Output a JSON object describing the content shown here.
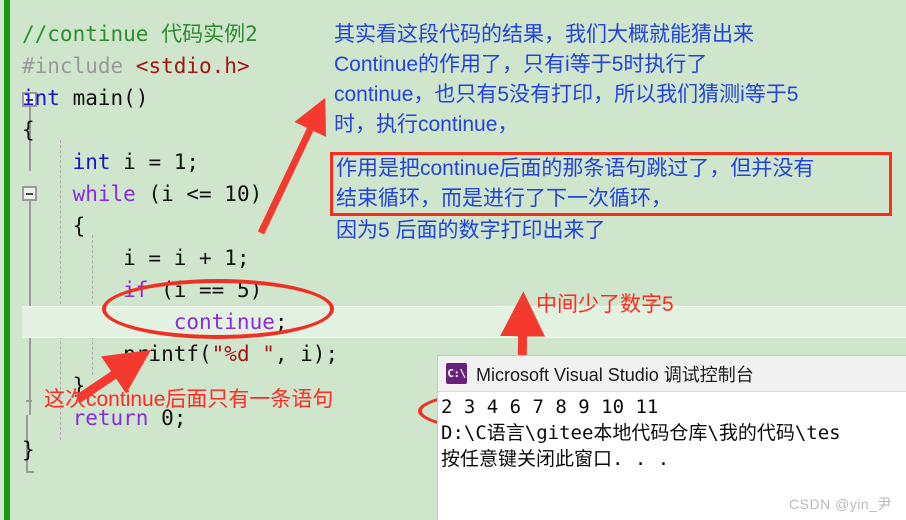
{
  "editor": {
    "code_lines": [
      {
        "segments": [
          {
            "text": "//continue 代码实例2",
            "cls": "cmt"
          }
        ]
      },
      {
        "segments": [
          {
            "text": "#include ",
            "cls": "pp"
          },
          {
            "text": "<stdio.h>",
            "cls": "hdr"
          }
        ]
      },
      {
        "segments": [
          {
            "text": "int",
            "cls": "kw"
          },
          {
            "text": " main()",
            "cls": "num"
          }
        ]
      },
      {
        "segments": [
          {
            "text": "{",
            "cls": "num"
          }
        ]
      },
      {
        "segments": [
          {
            "text": "    ",
            "cls": "num"
          },
          {
            "text": "int",
            "cls": "kw"
          },
          {
            "text": " i = 1;",
            "cls": "num"
          }
        ]
      },
      {
        "segments": [
          {
            "text": "    ",
            "cls": "num"
          },
          {
            "text": "while",
            "cls": "kw2"
          },
          {
            "text": " (i <= 10)",
            "cls": "num"
          }
        ]
      },
      {
        "segments": [
          {
            "text": "    {",
            "cls": "num"
          }
        ]
      },
      {
        "segments": [
          {
            "text": "        i = i + 1;",
            "cls": "num"
          }
        ]
      },
      {
        "segments": [
          {
            "text": "        ",
            "cls": "num"
          },
          {
            "text": "if",
            "cls": "kw2"
          },
          {
            "text": " (i == 5)",
            "cls": "num"
          }
        ]
      },
      {
        "segments": [
          {
            "text": "            ",
            "cls": "num"
          },
          {
            "text": "continue",
            "cls": "kw2"
          },
          {
            "text": ";",
            "cls": "num"
          }
        ]
      },
      {
        "segments": [
          {
            "text": "        printf(",
            "cls": "num"
          },
          {
            "text": "\"%d \"",
            "cls": "str"
          },
          {
            "text": ", i);",
            "cls": "num"
          }
        ]
      },
      {
        "segments": [
          {
            "text": "    }",
            "cls": "num"
          }
        ]
      },
      {
        "segments": [
          {
            "text": "    ",
            "cls": "num"
          },
          {
            "text": "return",
            "cls": "kw2"
          },
          {
            "text": " 0;",
            "cls": "num"
          }
        ]
      },
      {
        "segments": [
          {
            "text": "}",
            "cls": "num"
          }
        ]
      }
    ],
    "highlighted_line_index": 9,
    "margin_color": "#119b11"
  },
  "annotations": {
    "blue_top": "其实看这段代码的结果，我们大概就能猜出来\nContinue的作用了，只有i等于5时执行了\ncontinue，也只有5没有打印，所以我们猜测i等于5\n时，执行continue，",
    "blue_boxed": "作用是把continue后面的那条语句跳过了，但并没有\n结束循环，而是进行了下一次循环，",
    "blue_bottom": "因为5 后面的数字打印出来了",
    "red_missing_five": "中间少了数字5",
    "red_only_one_stmt": "这次continue后面只有一条语句",
    "blue_color": "#2244dd",
    "red_color": "#ff2a21",
    "box_color": "#fb2c1c",
    "ellipse_color": "#ee3124"
  },
  "console": {
    "icon": "cmd-icon",
    "icon_text": "C:\\",
    "title": "Microsoft Visual Studio 调试控制台",
    "output_lines": [
      "2 3 4 6 7 8 9 10 11",
      "D:\\C语言\\gitee本地代码仓库\\我的代码\\tes",
      "按任意键关闭此窗口. . ."
    ]
  },
  "watermark": "CSDN @yin_尹"
}
